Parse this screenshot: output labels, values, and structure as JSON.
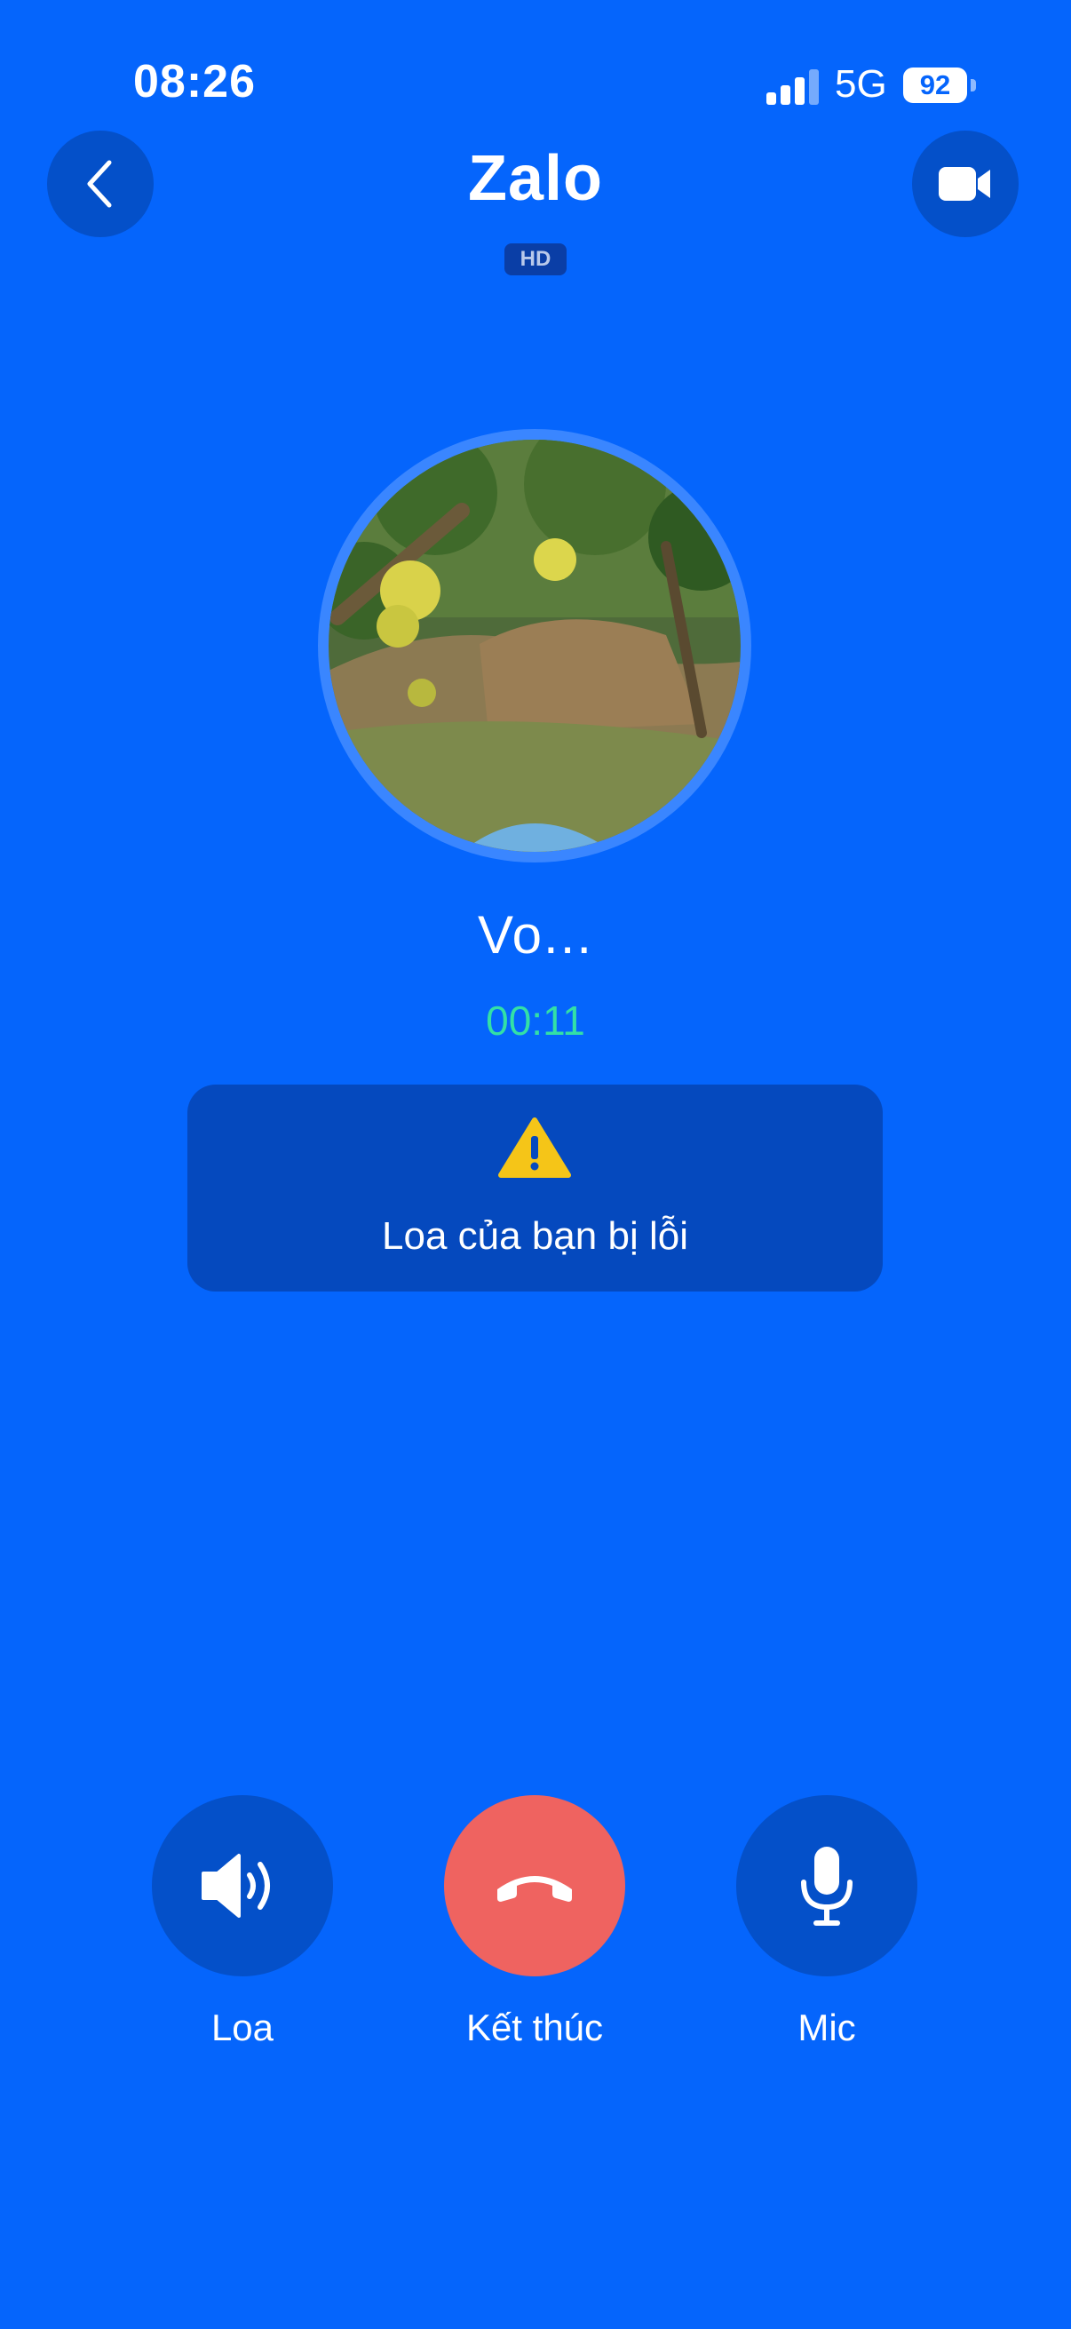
{
  "status_bar": {
    "time": "08:26",
    "network": "5G",
    "battery": "92"
  },
  "header": {
    "title": "Zalo",
    "quality_badge": "HD",
    "back_icon": "chevron-left-icon",
    "video_icon": "video-camera-icon"
  },
  "caller": {
    "name": "Vo...",
    "duration": "00:11"
  },
  "warning": {
    "icon": "warning-triangle-icon",
    "message": "Loa của bạn bị lỗi"
  },
  "controls": {
    "speaker_label": "Loa",
    "end_label": "Kết thúc",
    "mic_label": "Mic"
  },
  "colors": {
    "background": "#0565fc",
    "button_dark": "#0450c9",
    "end_call": "#ef6360",
    "timer": "#33e0a6",
    "warning": "#f5c518"
  }
}
